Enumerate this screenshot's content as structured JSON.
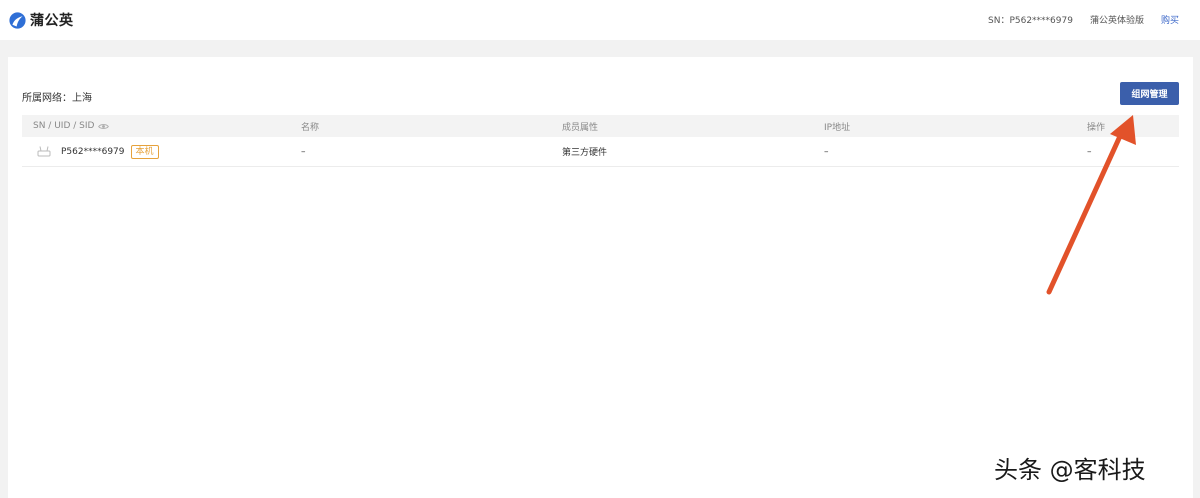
{
  "header": {
    "logo_text": "蒲公英",
    "sn_text": "SN：P562****6979",
    "edition": "蒲公英体验版",
    "buy": "购买"
  },
  "panel": {
    "network_label": "所属网络：上海",
    "manage_button": "组网管理"
  },
  "table": {
    "columns": [
      "SN / UID / SID",
      "名称",
      "成员属性",
      "IP地址",
      "操作"
    ],
    "rows": [
      {
        "sn": "P562****6979",
        "badge": "本机",
        "name": "–",
        "attribute": "第三方硬件",
        "ip": "–",
        "action": "–"
      }
    ]
  },
  "watermark": "头条 @客科技",
  "colors": {
    "brand_blue": "#3b5fab",
    "link_blue": "#3a66c8",
    "badge_orange": "#e6a23c",
    "arrow_red": "#e2522a"
  },
  "icons": {
    "logo": "dandelion-logo-icon",
    "eye": "eye-icon",
    "device": "router-device-icon",
    "arrow": "annotation-arrow"
  }
}
